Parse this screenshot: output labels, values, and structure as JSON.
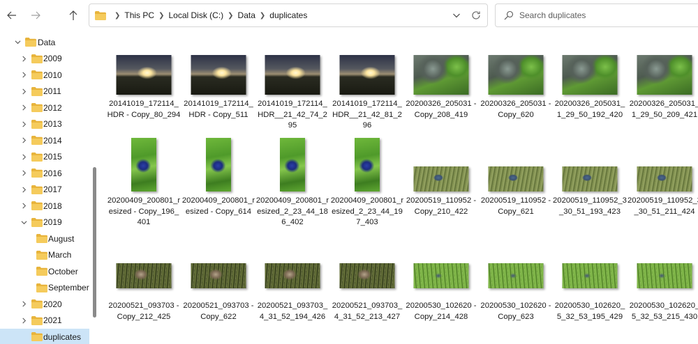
{
  "toolbar": {
    "back_icon": "arrow-left-icon",
    "forward_icon": "arrow-right-icon",
    "up_icon": "arrow-up-icon"
  },
  "address": {
    "crumbs": [
      "This PC",
      "Local Disk (C:)",
      "Data",
      "duplicates"
    ]
  },
  "search": {
    "placeholder": "Search duplicates"
  },
  "sidebar": {
    "items": [
      {
        "label": "Data",
        "level": 0,
        "expanded": true
      },
      {
        "label": "2009",
        "level": 1,
        "expanded": false
      },
      {
        "label": "2010",
        "level": 1,
        "expanded": false
      },
      {
        "label": "2011",
        "level": 1,
        "expanded": false
      },
      {
        "label": "2012",
        "level": 1,
        "expanded": false
      },
      {
        "label": "2013",
        "level": 1,
        "expanded": false
      },
      {
        "label": "2014",
        "level": 1,
        "expanded": false
      },
      {
        "label": "2015",
        "level": 1,
        "expanded": false
      },
      {
        "label": "2016",
        "level": 1,
        "expanded": false
      },
      {
        "label": "2017",
        "level": 1,
        "expanded": false
      },
      {
        "label": "2018",
        "level": 1,
        "expanded": false
      },
      {
        "label": "2019",
        "level": 1,
        "expanded": true
      },
      {
        "label": "August",
        "level": 2,
        "expanded": null
      },
      {
        "label": "March",
        "level": 2,
        "expanded": null
      },
      {
        "label": "October",
        "level": 2,
        "expanded": null
      },
      {
        "label": "September",
        "level": 2,
        "expanded": null
      },
      {
        "label": "2020",
        "level": 1,
        "expanded": false
      },
      {
        "label": "2021",
        "level": 1,
        "expanded": false
      },
      {
        "label": "duplicates",
        "level": 1,
        "expanded": null,
        "selected": true
      }
    ]
  },
  "files": [
    {
      "name": "20141019_172114_HDR - Copy_80_294",
      "thumb": "sunset"
    },
    {
      "name": "20141019_172114_HDR - Copy_511",
      "thumb": "sunset"
    },
    {
      "name": "20141019_172114_HDR__21_42_74_295",
      "thumb": "sunset"
    },
    {
      "name": "20141019_172114_HDR__21_42_81_296",
      "thumb": "sunset"
    },
    {
      "name": "20200326_205031 - Copy_208_419",
      "thumb": "rock"
    },
    {
      "name": "20200326_205031 - Copy_620",
      "thumb": "rock"
    },
    {
      "name": "20200326_205031_1_29_50_192_420",
      "thumb": "rock"
    },
    {
      "name": "20200326_205031_1_29_50_209_421",
      "thumb": "rock"
    },
    {
      "name": "20200409_200801_resized - Copy_196_401",
      "thumb": "butterfly"
    },
    {
      "name": "20200409_200801_resized - Copy_614",
      "thumb": "butterfly"
    },
    {
      "name": "20200409_200801_resized_2_23_44_186_402",
      "thumb": "butterfly"
    },
    {
      "name": "20200409_200801_resized_2_23_44_197_403",
      "thumb": "butterfly"
    },
    {
      "name": "20200519_110952 - Copy_210_422",
      "thumb": "grass1"
    },
    {
      "name": "20200519_110952 - Copy_621",
      "thumb": "grass1"
    },
    {
      "name": "20200519_110952_3_30_51_193_423",
      "thumb": "grass1"
    },
    {
      "name": "20200519_110952_3_30_51_211_424",
      "thumb": "grass1"
    },
    {
      "name": "20200521_093703 - Copy_212_425",
      "thumb": "grass2"
    },
    {
      "name": "20200521_093703 - Copy_622",
      "thumb": "grass2"
    },
    {
      "name": "20200521_093703_4_31_52_194_426",
      "thumb": "grass2"
    },
    {
      "name": "20200521_093703_4_31_52_213_427",
      "thumb": "grass2"
    },
    {
      "name": "20200530_102620 - Copy_214_428",
      "thumb": "grass3"
    },
    {
      "name": "20200530_102620 - Copy_623",
      "thumb": "grass3"
    },
    {
      "name": "20200530_102620_5_32_53_195_429",
      "thumb": "grass3"
    },
    {
      "name": "20200530_102620_5_32_53_215_430",
      "thumb": "grass3"
    }
  ],
  "colors": {
    "folder": "#f0c24b",
    "selection": "#cce4f7"
  }
}
